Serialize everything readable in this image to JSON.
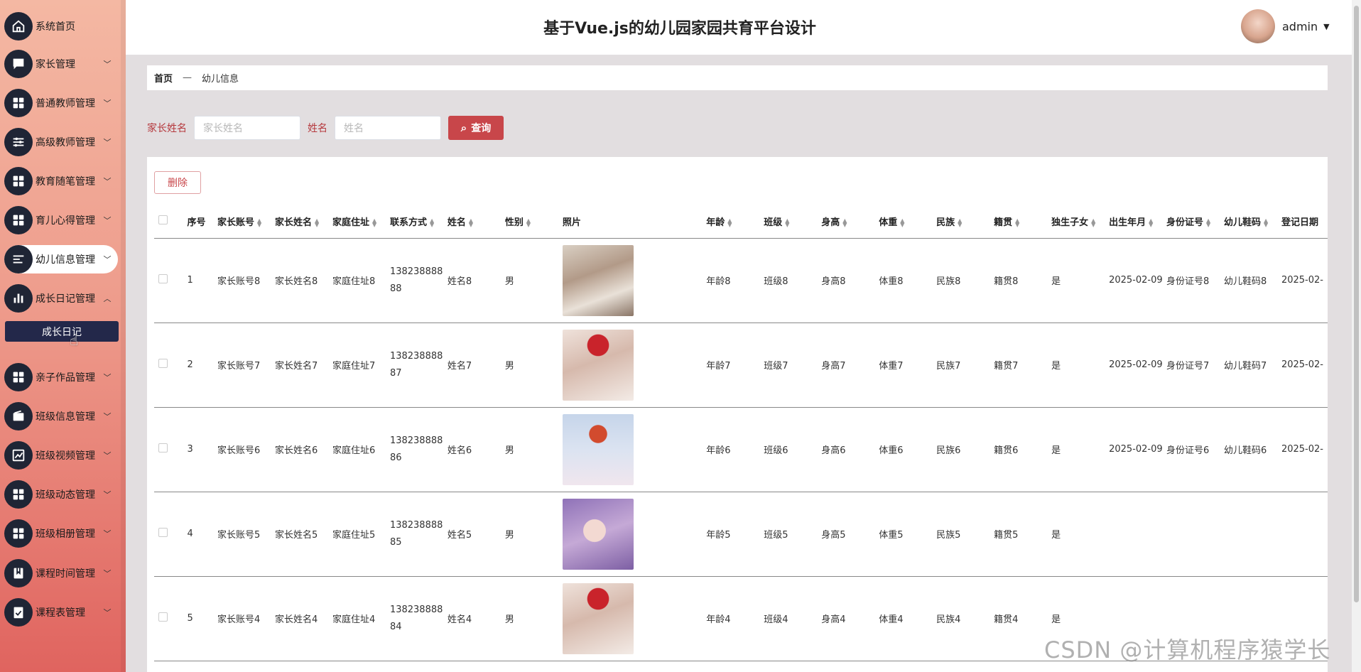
{
  "app": {
    "title": "基于Vue.js的幼儿园家园共育平台设计"
  },
  "user": {
    "name": "admin"
  },
  "sidebar": {
    "items": [
      {
        "label": "系统首页",
        "icon": "home-icon",
        "chevron": ""
      },
      {
        "label": "家长管理",
        "icon": "chat-icon",
        "chevron": "﹀"
      },
      {
        "label": "普通教师管理",
        "icon": "grid-icon",
        "chevron": "﹀"
      },
      {
        "label": "高级教师管理",
        "icon": "sliders-icon",
        "chevron": "﹀"
      },
      {
        "label": "教育随笔管理",
        "icon": "grid-icon",
        "chevron": "﹀"
      },
      {
        "label": "育儿心得管理",
        "icon": "grid-icon",
        "chevron": "﹀"
      },
      {
        "label": "幼儿信息管理",
        "icon": "list-icon",
        "chevron": "﹀"
      },
      {
        "label": "成长日记管理",
        "icon": "bar-chart-icon",
        "chevron": "︿"
      },
      {
        "label": "亲子作品管理",
        "icon": "grid-icon",
        "chevron": "﹀"
      },
      {
        "label": "班级信息管理",
        "icon": "wallet-icon",
        "chevron": "﹀"
      },
      {
        "label": "班级视频管理",
        "icon": "line-chart-icon",
        "chevron": "﹀"
      },
      {
        "label": "班级动态管理",
        "icon": "grid-icon",
        "chevron": "﹀"
      },
      {
        "label": "班级相册管理",
        "icon": "grid-icon",
        "chevron": "﹀"
      },
      {
        "label": "课程时间管理",
        "icon": "book-icon",
        "chevron": "﹀"
      },
      {
        "label": "课程表管理",
        "icon": "checklist-icon",
        "chevron": "﹀"
      }
    ],
    "submenu": {
      "label": "成长日记"
    }
  },
  "breadcrumb": {
    "home": "首页",
    "separator": "—",
    "current": "幼儿信息"
  },
  "search": {
    "parent_label": "家长姓名",
    "parent_placeholder": "家长姓名",
    "name_label": "姓名",
    "name_placeholder": "姓名",
    "button_label": "查询"
  },
  "toolbar": {
    "delete_label": "删除"
  },
  "table": {
    "headers": [
      "序号",
      "家长账号",
      "家长姓名",
      "家庭住址",
      "联系方式",
      "姓名",
      "性别",
      "照片",
      "年龄",
      "班级",
      "身高",
      "体重",
      "民族",
      "籍贯",
      "独生子女",
      "出生年月",
      "身份证号",
      "幼儿鞋码",
      "登记日期"
    ],
    "rows": [
      {
        "idx": "1",
        "account": "家长账号8",
        "parent": "家长姓名8",
        "address": "家庭住址8",
        "phone": "13823888888",
        "name": "姓名8",
        "gender": "男",
        "age": "年龄8",
        "class": "班级8",
        "height": "身高8",
        "weight": "体重8",
        "ethnicity": "民族8",
        "origin": "籍贯8",
        "only_child": "是",
        "birth": "2025-02-09",
        "id_no": "身份证号8",
        "shoe": "幼儿鞋码8",
        "reg": "2025-02-"
      },
      {
        "idx": "2",
        "account": "家长账号7",
        "parent": "家长姓名7",
        "address": "家庭住址7",
        "phone": "13823888887",
        "name": "姓名7",
        "gender": "男",
        "age": "年龄7",
        "class": "班级7",
        "height": "身高7",
        "weight": "体重7",
        "ethnicity": "民族7",
        "origin": "籍贯7",
        "only_child": "是",
        "birth": "2025-02-09",
        "id_no": "身份证号7",
        "shoe": "幼儿鞋码7",
        "reg": "2025-02-"
      },
      {
        "idx": "3",
        "account": "家长账号6",
        "parent": "家长姓名6",
        "address": "家庭住址6",
        "phone": "13823888886",
        "name": "姓名6",
        "gender": "男",
        "age": "年龄6",
        "class": "班级6",
        "height": "身高6",
        "weight": "体重6",
        "ethnicity": "民族6",
        "origin": "籍贯6",
        "only_child": "是",
        "birth": "2025-02-09",
        "id_no": "身份证号6",
        "shoe": "幼儿鞋码6",
        "reg": "2025-02-"
      },
      {
        "idx": "4",
        "account": "家长账号5",
        "parent": "家长姓名5",
        "address": "家庭住址5",
        "phone": "13823888885",
        "name": "姓名5",
        "gender": "男",
        "age": "年龄5",
        "class": "班级5",
        "height": "身高5",
        "weight": "体重5",
        "ethnicity": "民族5",
        "origin": "籍贯5",
        "only_child": "是",
        "birth": "",
        "id_no": "",
        "shoe": "",
        "reg": ""
      },
      {
        "idx": "5",
        "account": "家长账号4",
        "parent": "家长姓名4",
        "address": "家庭住址4",
        "phone": "13823888884",
        "name": "姓名4",
        "gender": "男",
        "age": "年龄4",
        "class": "班级4",
        "height": "身高4",
        "weight": "体重4",
        "ethnicity": "民族4",
        "origin": "籍贯4",
        "only_child": "是",
        "birth": "",
        "id_no": "",
        "shoe": "",
        "reg": ""
      }
    ]
  },
  "watermark": "CSDN @计算机程序猿学长",
  "colors": {
    "accent": "#c8464a",
    "sidebar_top": "#f4b8a3",
    "sidebar_bottom": "#e0645f",
    "icon_bg": "#1f2535",
    "submenu_bg": "#23284a"
  }
}
